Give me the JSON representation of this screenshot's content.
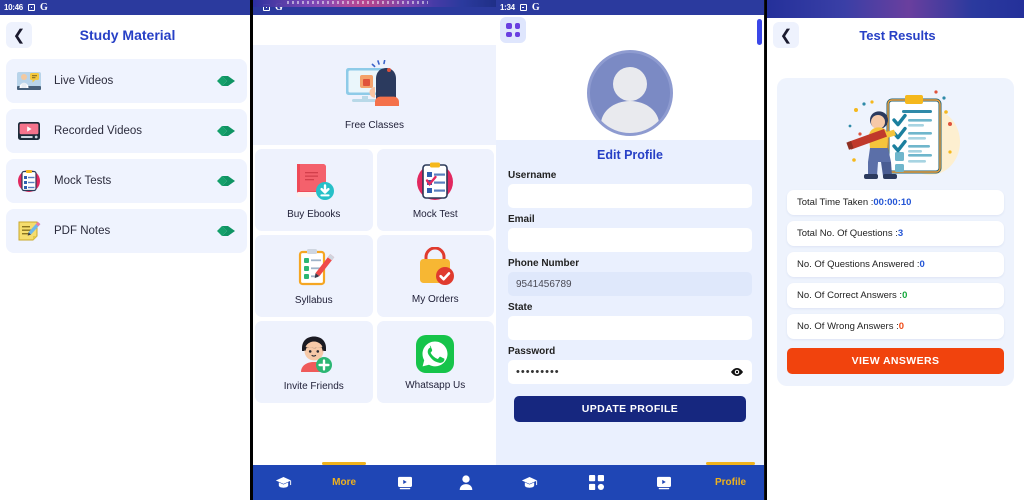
{
  "panels": {
    "study_material": {
      "status": {
        "time": "10:46",
        "icons": [
          "square-icon",
          "google-icon"
        ]
      },
      "back_icon": "chevron-left-icon",
      "title": "Study Material",
      "items": [
        {
          "label": "Live Videos",
          "icon": "live-video-icon",
          "arrow": "arrow-right-icon"
        },
        {
          "label": "Recorded Videos",
          "icon": "recorded-video-icon",
          "arrow": "arrow-right-icon"
        },
        {
          "label": "Mock Tests",
          "icon": "mock-test-icon",
          "arrow": "arrow-right-icon"
        },
        {
          "label": "PDF Notes",
          "icon": "pdf-notes-icon",
          "arrow": "arrow-right-icon"
        }
      ]
    },
    "more_menu": {
      "status": {
        "time": "",
        "icons": [
          "square-icon",
          "google-icon"
        ]
      },
      "featured": {
        "label": "Free Classes",
        "icon": "free-classes-icon"
      },
      "tiles": [
        {
          "label": "Buy Ebooks",
          "icon": "ebook-icon"
        },
        {
          "label": "Mock Test",
          "icon": "clipboard-test-icon"
        },
        {
          "label": "Syllabus",
          "icon": "syllabus-icon"
        },
        {
          "label": "My Orders",
          "icon": "shopping-bag-icon"
        },
        {
          "label": "Invite Friends",
          "icon": "invite-friend-icon"
        },
        {
          "label": "Whatsapp Us",
          "icon": "whatsapp-icon"
        }
      ],
      "nav": [
        {
          "label": "",
          "icon": "graduation-cap-icon",
          "active": false
        },
        {
          "label": "More",
          "icon": "",
          "active": true
        },
        {
          "label": "",
          "icon": "video-screen-icon",
          "active": false
        },
        {
          "label": "",
          "icon": "person-icon",
          "active": false
        }
      ]
    },
    "edit_profile": {
      "status": {
        "time": "1:34",
        "icons": [
          "square-icon",
          "google-icon"
        ]
      },
      "apps_icon": "apps-grid-icon",
      "avatar": "avatar-placeholder-icon",
      "title": "Edit Profile",
      "fields": [
        {
          "label": "Username",
          "value": "",
          "placeholder": "",
          "filled": false
        },
        {
          "label": "Email",
          "value": "",
          "placeholder": "",
          "filled": false
        },
        {
          "label": "Phone Number",
          "value": "9541456789",
          "placeholder": "",
          "filled": true
        },
        {
          "label": "State",
          "value": "",
          "placeholder": "",
          "filled": false
        }
      ],
      "password": {
        "label": "Password",
        "value": "•••••••••",
        "toggle_icon": "eye-icon"
      },
      "submit_label": "UPDATE PROFILE",
      "nav": [
        {
          "label": "",
          "icon": "graduation-cap-icon",
          "active": false
        },
        {
          "label": "",
          "icon": "apps-grid-icon",
          "active": false
        },
        {
          "label": "",
          "icon": "video-screen-icon",
          "active": false
        },
        {
          "label": "Profile",
          "icon": "",
          "active": true
        }
      ]
    },
    "test_results": {
      "back_icon": "chevron-left-icon",
      "title": "Test Results",
      "illustration": "person-checklist-icon",
      "rows": [
        {
          "label": "Total Time Taken : ",
          "value": "00:00:10",
          "value_color": "#2355d6"
        },
        {
          "label": "Total No. Of Questions : ",
          "value": "3",
          "value_color": "#2355d6"
        },
        {
          "label": "No. Of Questions Answered : ",
          "value": "0",
          "value_color": "#2355d6"
        },
        {
          "label": "No. Of Correct Answers : ",
          "value": "0",
          "value_color": "#15a83c"
        },
        {
          "label": "No. Of Wrong Answers : ",
          "value": "0",
          "value_color": "#ef4a16"
        }
      ],
      "view_answers_label": "VIEW ANSWERS"
    }
  },
  "colors": {
    "brand_blue": "#2740c6",
    "nav_blue": "#1f46b5",
    "accent_yellow": "#f0b21c",
    "orange": "#f1430d",
    "card_bg": "#eef2fd",
    "deep_blue": "#16277f"
  }
}
